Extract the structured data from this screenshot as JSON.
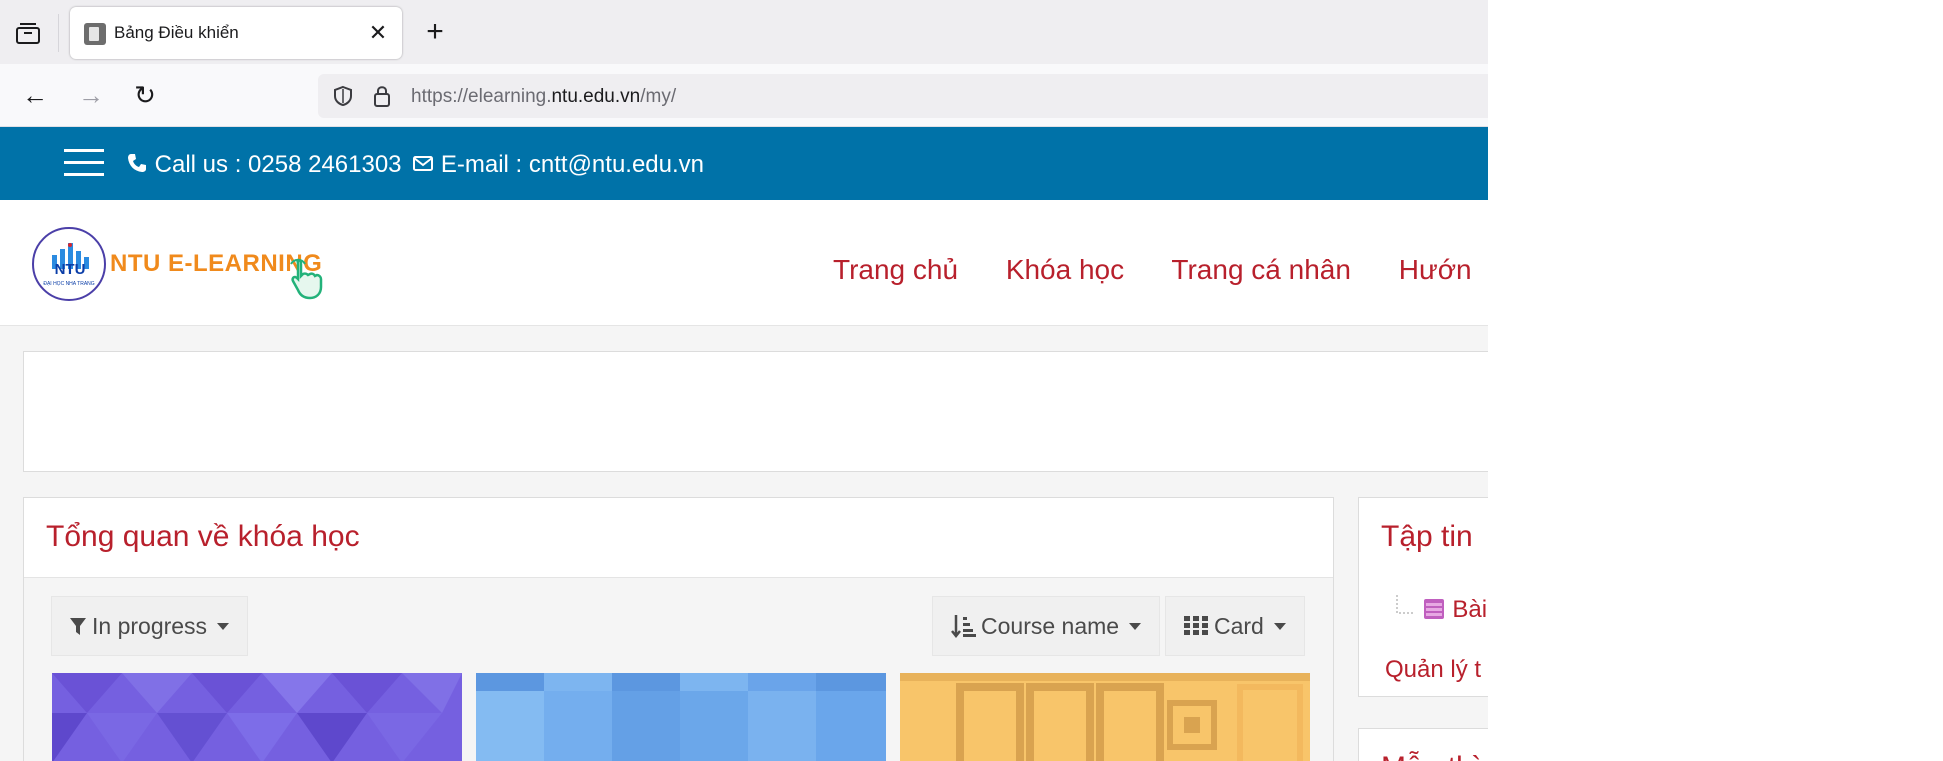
{
  "browser": {
    "tab_title": "Bảng Điều khiển",
    "close_glyph": "✕",
    "new_tab_glyph": "+",
    "back_glyph": "←",
    "forward_glyph": "→",
    "reload_glyph": "↻",
    "url": {
      "prefix": "https://elearning.",
      "domain": "ntu.edu.vn",
      "path": "/my/"
    }
  },
  "site": {
    "call": "Call us : 0258 2461303",
    "email": "E-mail : cntt@ntu.edu.vn",
    "logo_text": "NTU E-LEARNING",
    "logo_mark": "NTU",
    "logo_subtext": "ĐẠI HỌC NHA TRANG",
    "menu": [
      "Trang chủ",
      "Khóa học",
      "Trang cá nhân",
      "Hướn"
    ]
  },
  "course_overview": {
    "title": "Tổng quan về khóa học",
    "filter": "In progress",
    "sort": "Course name",
    "view": "Card"
  },
  "sidebar": {
    "files_title": "Tập tin",
    "file_item": "Bài",
    "manage_link": "Quản lý t",
    "next_title": "Mẫu thì"
  },
  "colors": {
    "brand_blue": "#0072a8",
    "accent_red": "#b8202c",
    "logo_orange": "#f08a1c"
  }
}
